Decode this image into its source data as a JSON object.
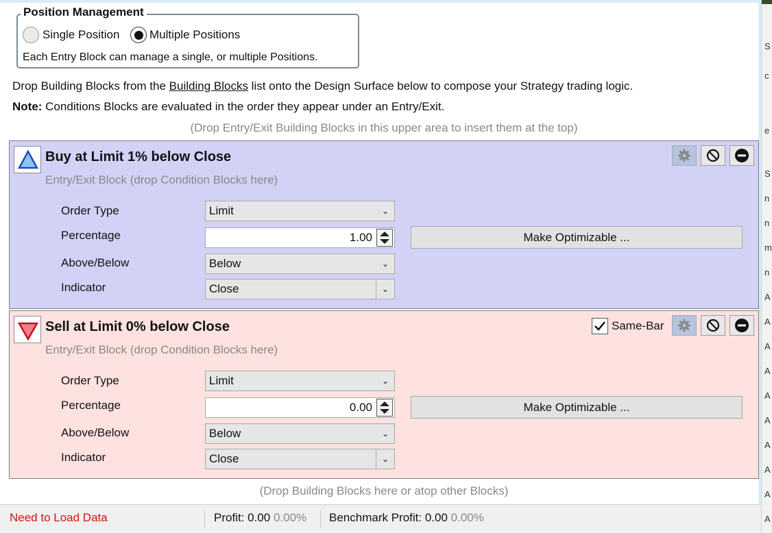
{
  "position_management": {
    "title": "Position Management",
    "options": [
      "Single Position",
      "Multiple Positions"
    ],
    "selected": "Multiple Positions",
    "description": "Each Entry Block can manage a single, or multiple Positions."
  },
  "instructions": {
    "prefix": "Drop Building Blocks from the ",
    "link": "Building Blocks",
    "suffix": " list onto the Design Surface below to compose your Strategy trading logic.",
    "note_label": "Note:",
    "note_text": " Conditions Blocks are evaluated in the order they appear under an Entry/Exit."
  },
  "drop_top_hint": "(Drop Entry/Exit Building Blocks in this upper area to insert them at the top)",
  "drop_bottom_hint": "(Drop Building Blocks here or atop other Blocks)",
  "blocks": [
    {
      "title": "Buy at Limit 1% below Close",
      "subtitle": "Entry/Exit Block (drop Condition Blocks here)",
      "fields": [
        {
          "label": "Order Type",
          "value": "Limit"
        },
        {
          "label": "Percentage",
          "value": "1.00"
        },
        {
          "label": "Above/Below",
          "value": "Below"
        },
        {
          "label": "Indicator",
          "value": "Close"
        }
      ],
      "optimize_label": "Make Optimizable ...",
      "color": "#d2d2f6"
    },
    {
      "title": "Sell at Limit 0% below Close",
      "subtitle": "Entry/Exit Block (drop Condition Blocks here)",
      "same_bar_label": "Same-Bar",
      "same_bar_checked": true,
      "fields": [
        {
          "label": "Order Type",
          "value": "Limit"
        },
        {
          "label": "Percentage",
          "value": "0.00"
        },
        {
          "label": "Above/Below",
          "value": "Below"
        },
        {
          "label": "Indicator",
          "value": "Close"
        }
      ],
      "optimize_label": "Make Optimizable ...",
      "color": "#fde2e0"
    }
  ],
  "status_bar": {
    "load_message": "Need to Load Data",
    "profit_label": "Profit: 0.00",
    "profit_pct": "0.00%",
    "benchmark_label": "Benchmark Profit: 0.00",
    "benchmark_pct": "0.00%"
  },
  "right_strip_chars": [
    "S",
    "c",
    "e",
    "S",
    "n",
    "n",
    "m",
    "n",
    "A",
    "A",
    "A",
    "A",
    "A",
    "A",
    "A",
    "A",
    "A",
    "A"
  ]
}
